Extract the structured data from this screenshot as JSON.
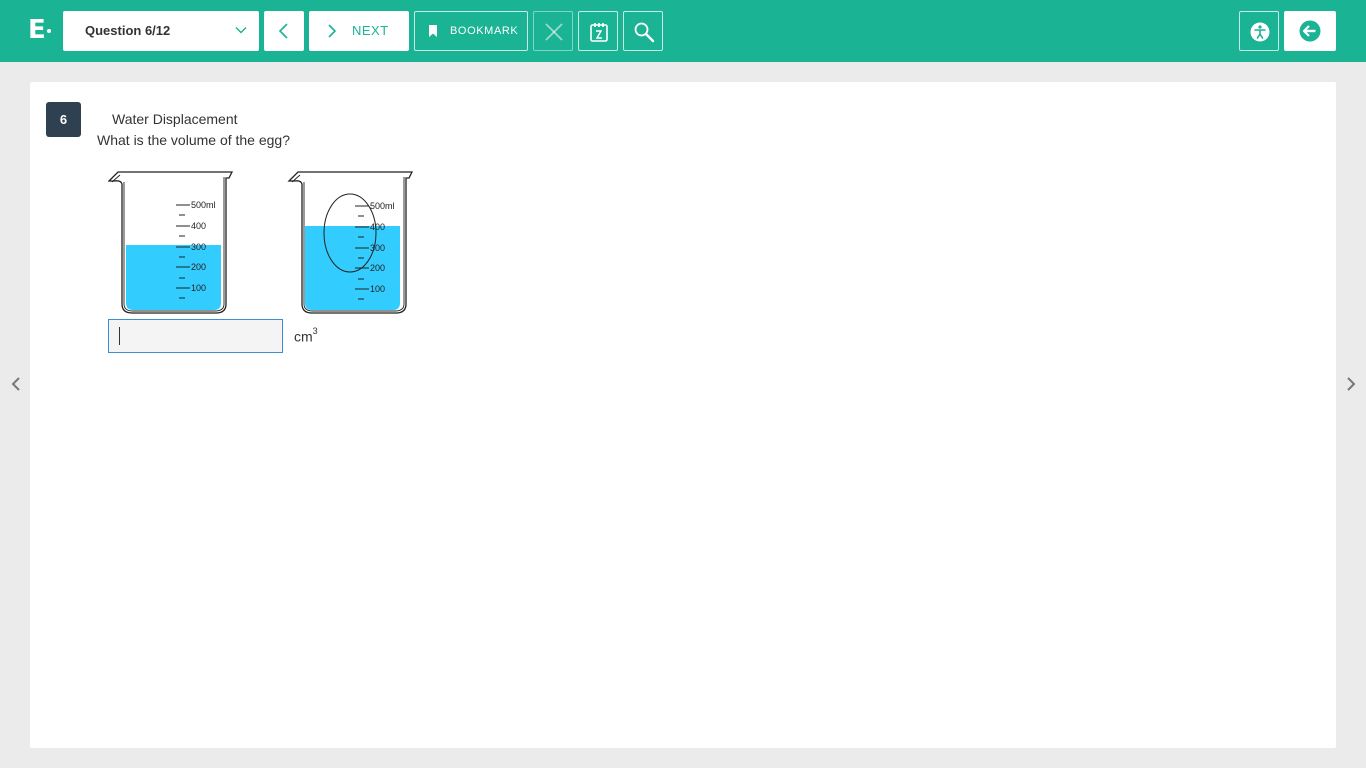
{
  "header": {
    "logo_letter": "E",
    "question_selector": "Question 6/12",
    "next_label": "NEXT",
    "bookmark_label": "BOOKMARK"
  },
  "question": {
    "number": "6",
    "title": "Water Displacement",
    "prompt": "What is the volume of the egg?",
    "answer_value": "",
    "unit_base": "cm",
    "unit_exp": "3"
  },
  "figure": {
    "beaker_scale_labels": [
      "500ml",
      "400",
      "300",
      "200",
      "100"
    ],
    "water_color": "#33ccff"
  },
  "colors": {
    "brand": "#1ab394",
    "question_badge": "#2f4050",
    "answer_border": "#3b8ed6"
  },
  "icons": [
    "logo",
    "chevron-down-icon",
    "chevron-left-icon",
    "chevron-right-icon",
    "bookmark-icon",
    "close-icon",
    "notepad-icon",
    "search-icon",
    "accessibility-icon",
    "exit-icon"
  ]
}
